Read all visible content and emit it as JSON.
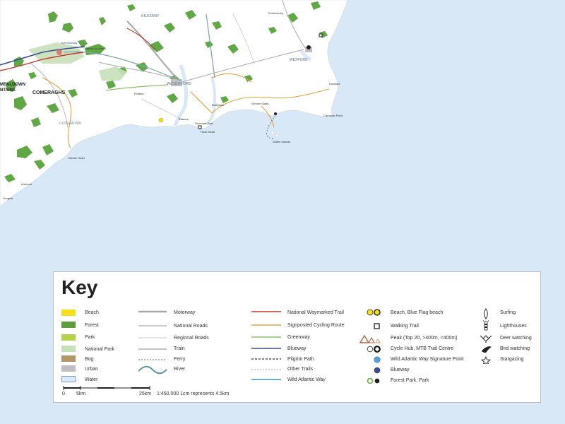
{
  "map": {
    "background_sea": "#d8e8f6",
    "land": "#ffffff",
    "forest_color": "#5fa845",
    "labels": {
      "comeraghs": "COMERAGHS",
      "meeldown": "MEALDOWN",
      "ntains": "NTAINS",
      "waterford": "WATERFORD",
      "dungarvan": "DUNGARVAN",
      "helvick": "Helvick Head",
      "tramore": "Tramore",
      "carnsore": "Carnsore Point",
      "rosslare": "Rosslare",
      "kilmore": "Kilmore Quay",
      "dunmore": "Dunmore East",
      "hookhead": "Hook Head",
      "ardmore": "Ardmore",
      "wexford": "WEXFORD",
      "suir": "Suir Blueway",
      "ballyhack": "Ballyhack",
      "kilkenny": "KILKENNY",
      "enniscorthy": "Enniscorthy",
      "youghal": "Youghal",
      "carrick": "Carrick-on-Suir",
      "portlaw": "Portlaw",
      "saltees": "Saltee Islands"
    }
  },
  "key": {
    "title": "Key",
    "col1": [
      {
        "label": "Beach",
        "color": "#f5e11a"
      },
      {
        "label": "Forest",
        "color": "#5a9e3e"
      },
      {
        "label": "Park",
        "color": "#b6d24c"
      },
      {
        "label": "National Park",
        "color": "#c8e0b8"
      },
      {
        "label": "Bog",
        "color": "#b3966a"
      },
      {
        "label": "Urban",
        "color": "#c0bec4"
      },
      {
        "label": "Water",
        "color": "#dceaf8"
      }
    ],
    "col2": [
      {
        "label": "Motorway",
        "style": "motorway"
      },
      {
        "label": "National Roads",
        "style": "national"
      },
      {
        "label": "Regional Roads",
        "style": "regional"
      },
      {
        "label": "Train",
        "style": "train"
      },
      {
        "label": "Ferry",
        "style": "ferry"
      },
      {
        "label": "River",
        "style": "river"
      }
    ],
    "col3": [
      {
        "label": "National Waymarked Trail",
        "color": "#c0392b"
      },
      {
        "label": "Signposted Cycling Route",
        "color": "#e2a33a"
      },
      {
        "label": "Greenway",
        "color": "#8cc26a"
      },
      {
        "label": "Blueway",
        "color": "#3a4f8f"
      },
      {
        "label": "Pilgrim Path",
        "color": "#333333"
      },
      {
        "label": "Other Trails",
        "color": "#888888"
      },
      {
        "label": "Wild Atlantic Way",
        "color": "#5aa3d6"
      }
    ],
    "col4": [
      {
        "label": "Beach, Blue Flag beach",
        "icon": "beach-icon"
      },
      {
        "label": "Walking Trail",
        "icon": "walking-trail-icon"
      },
      {
        "label": "Peak (Top 20, >400m, <400m)",
        "icon": "peak-icon"
      },
      {
        "label": "Cycle Hub, MTB Trail Centre",
        "icon": "cycle-hub-icon"
      },
      {
        "label": "Wild Atlantic Way Signature Point",
        "icon": "signature-point-icon"
      },
      {
        "label": "Blueway",
        "icon": "blueway-point-icon"
      },
      {
        "label": "Forest Park, Park",
        "icon": "forest-park-icon"
      }
    ],
    "col5": [
      {
        "label": "Surfing",
        "icon": "surfing-icon"
      },
      {
        "label": "Lighthouses",
        "icon": "lighthouse-icon"
      },
      {
        "label": "Deer watching",
        "icon": "deer-icon"
      },
      {
        "label": "Bird watching",
        "icon": "bird-icon"
      },
      {
        "label": "Stargazing",
        "icon": "star-icon"
      }
    ],
    "scale": {
      "t0": "0",
      "t5": "5km",
      "t25": "25km",
      "ratio": "1:450,000 1cm represents 4.5km"
    }
  }
}
